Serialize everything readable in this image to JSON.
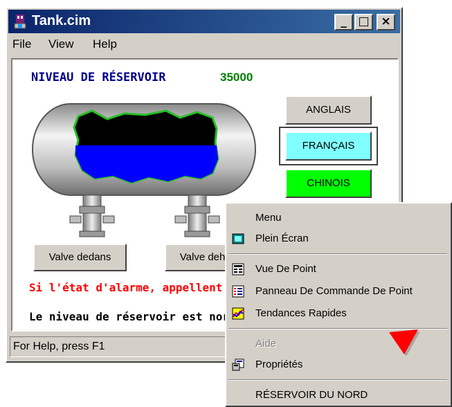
{
  "window": {
    "title": "Tank.cim",
    "minimize_glyph": "_",
    "maximize_glyph": "□",
    "close_glyph": "×"
  },
  "menubar": {
    "file": "File",
    "view": "View",
    "help": "Help"
  },
  "tank": {
    "level_label": "NIVEAU DE RÉSERVOIR",
    "level_value": "35000"
  },
  "language_buttons": [
    {
      "label": "ANGLAIS",
      "color": "#d4d0c8"
    },
    {
      "label": "FRANÇAIS",
      "color": "#7fffff"
    },
    {
      "label": "CHINOIS",
      "color": "#00ff00"
    }
  ],
  "valves": {
    "in_label": "Valve dedans",
    "out_label": "Valve dehors"
  },
  "messages": {
    "alarm": "Si l'état d'alarme, appellent",
    "normal": "Le niveau de réservoir est normal"
  },
  "statusbar": {
    "help_text": "For Help, press F1"
  },
  "context_menu": {
    "header": "Menu",
    "items": [
      {
        "label": "Plein Écran",
        "icon": "fullscreen-icon"
      },
      {
        "label": "Vue De Point",
        "icon": "point-view-icon"
      },
      {
        "label": "Panneau De Commande De Point",
        "icon": "control-panel-icon"
      },
      {
        "label": "Tendances Rapides",
        "icon": "quick-trends-icon"
      },
      {
        "label": "Aide",
        "icon": "",
        "disabled": true
      },
      {
        "label": "Propriétés",
        "icon": "properties-icon"
      },
      {
        "label": "RÉSERVOIR DU NORD",
        "icon": ""
      }
    ]
  },
  "colors": {
    "title_start": "#0a246a",
    "title_end": "#3a6ea5",
    "level_label": "#00008b",
    "level_value": "#008000",
    "alarm": "#ff0000",
    "liquid": "#0000ff",
    "cursor": "#ff0000"
  }
}
